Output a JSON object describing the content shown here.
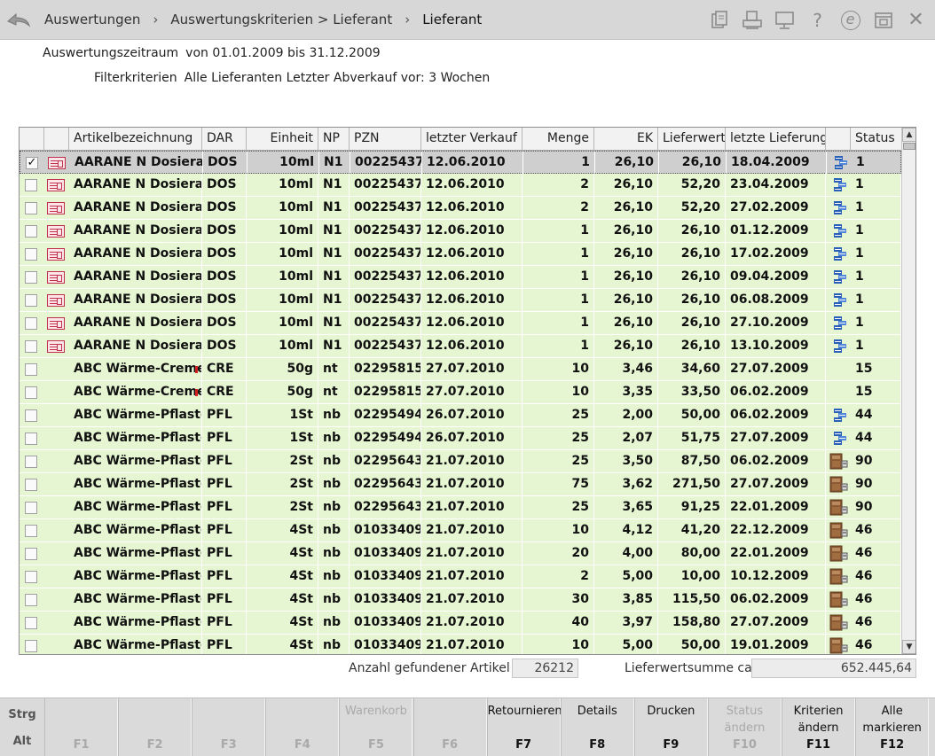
{
  "breadcrumb": [
    "Auswertungen",
    "Auswertungskriterien > Lieferant",
    "Lieferant"
  ],
  "toolbar_icons": [
    "clipboard-icon",
    "print-icon",
    "monitor-icon",
    "help-icon",
    "e-icon",
    "window-icon",
    "close-icon"
  ],
  "help_symbol": "?",
  "e_symbol": "e",
  "close_symbol": "✕",
  "period": {
    "label": "Auswertungszeitraum",
    "value": "von 01.01.2009 bis 31.12.2009"
  },
  "filter": {
    "label": "Filterkriterien",
    "value": "Alle Lieferanten Letzter Abverkauf vor: 3 Wochen"
  },
  "columns": [
    "Artikelbezeichnung",
    "DAR",
    "Einheit",
    "NP",
    "PZN",
    "letzter Verkauf",
    "Menge",
    "EK",
    "Lieferwert",
    "letzte Lieferung",
    "Status"
  ],
  "rows": [
    {
      "checked": true,
      "icon": "article",
      "name": "AARANE N Dosierae",
      "dar": "DOS",
      "einheit": "10ml",
      "np": "N1",
      "pzn": "00225437",
      "verkauf": "12.06.2010",
      "menge": "1",
      "ek": "26,10",
      "lieferwert": "26,10",
      "lieferung": "18.04.2009",
      "status_icon": "blue",
      "status": "1"
    },
    {
      "checked": false,
      "icon": "article",
      "name": "AARANE N Dosierae",
      "dar": "DOS",
      "einheit": "10ml",
      "np": "N1",
      "pzn": "00225437",
      "verkauf": "12.06.2010",
      "menge": "2",
      "ek": "26,10",
      "lieferwert": "52,20",
      "lieferung": "23.04.2009",
      "status_icon": "blue",
      "status": "1"
    },
    {
      "checked": false,
      "icon": "article",
      "name": "AARANE N Dosierae",
      "dar": "DOS",
      "einheit": "10ml",
      "np": "N1",
      "pzn": "00225437",
      "verkauf": "12.06.2010",
      "menge": "2",
      "ek": "26,10",
      "lieferwert": "52,20",
      "lieferung": "27.02.2009",
      "status_icon": "blue",
      "status": "1"
    },
    {
      "checked": false,
      "icon": "article",
      "name": "AARANE N Dosierae",
      "dar": "DOS",
      "einheit": "10ml",
      "np": "N1",
      "pzn": "00225437",
      "verkauf": "12.06.2010",
      "menge": "1",
      "ek": "26,10",
      "lieferwert": "26,10",
      "lieferung": "01.12.2009",
      "status_icon": "blue",
      "status": "1"
    },
    {
      "checked": false,
      "icon": "article",
      "name": "AARANE N Dosierae",
      "dar": "DOS",
      "einheit": "10ml",
      "np": "N1",
      "pzn": "00225437",
      "verkauf": "12.06.2010",
      "menge": "1",
      "ek": "26,10",
      "lieferwert": "26,10",
      "lieferung": "17.02.2009",
      "status_icon": "blue",
      "status": "1"
    },
    {
      "checked": false,
      "icon": "article",
      "name": "AARANE N Dosierae",
      "dar": "DOS",
      "einheit": "10ml",
      "np": "N1",
      "pzn": "00225437",
      "verkauf": "12.06.2010",
      "menge": "1",
      "ek": "26,10",
      "lieferwert": "26,10",
      "lieferung": "09.04.2009",
      "status_icon": "blue",
      "status": "1"
    },
    {
      "checked": false,
      "icon": "article",
      "name": "AARANE N Dosierae",
      "dar": "DOS",
      "einheit": "10ml",
      "np": "N1",
      "pzn": "00225437",
      "verkauf": "12.06.2010",
      "menge": "1",
      "ek": "26,10",
      "lieferwert": "26,10",
      "lieferung": "06.08.2009",
      "status_icon": "blue",
      "status": "1"
    },
    {
      "checked": false,
      "icon": "article",
      "name": "AARANE N Dosierae",
      "dar": "DOS",
      "einheit": "10ml",
      "np": "N1",
      "pzn": "00225437",
      "verkauf": "12.06.2010",
      "menge": "1",
      "ek": "26,10",
      "lieferwert": "26,10",
      "lieferung": "27.10.2009",
      "status_icon": "blue",
      "status": "1"
    },
    {
      "checked": false,
      "icon": "article",
      "name": "AARANE N Dosierae",
      "dar": "DOS",
      "einheit": "10ml",
      "np": "N1",
      "pzn": "00225437",
      "verkauf": "12.06.2010",
      "menge": "1",
      "ek": "26,10",
      "lieferwert": "26,10",
      "lieferung": "13.10.2009",
      "status_icon": "blue",
      "status": "1"
    },
    {
      "checked": false,
      "icon": "",
      "name": "ABC Wärme-Creme",
      "mark": true,
      "dar": "CRE",
      "einheit": "50g",
      "np": "nt",
      "pzn": "02295815",
      "verkauf": "27.07.2010",
      "menge": "10",
      "ek": "3,46",
      "lieferwert": "34,60",
      "lieferung": "27.07.2009",
      "status_icon": "",
      "status": "15"
    },
    {
      "checked": false,
      "icon": "",
      "name": "ABC Wärme-Creme",
      "mark": true,
      "dar": "CRE",
      "einheit": "50g",
      "np": "nt",
      "pzn": "02295815",
      "verkauf": "27.07.2010",
      "menge": "10",
      "ek": "3,35",
      "lieferwert": "33,50",
      "lieferung": "06.02.2009",
      "status_icon": "",
      "status": "15"
    },
    {
      "checked": false,
      "icon": "",
      "name": "ABC Wärme-Pflaster",
      "dar": "PFL",
      "einheit": "1St",
      "np": "nb",
      "pzn": "02295494",
      "verkauf": "26.07.2010",
      "menge": "25",
      "ek": "2,00",
      "lieferwert": "50,00",
      "lieferung": "06.02.2009",
      "status_icon": "blue",
      "status": "44"
    },
    {
      "checked": false,
      "icon": "",
      "name": "ABC Wärme-Pflaster",
      "dar": "PFL",
      "einheit": "1St",
      "np": "nb",
      "pzn": "02295494",
      "verkauf": "26.07.2010",
      "menge": "25",
      "ek": "2,07",
      "lieferwert": "51,75",
      "lieferung": "27.07.2009",
      "status_icon": "blue",
      "status": "44"
    },
    {
      "checked": false,
      "icon": "",
      "name": "ABC Wärme-Pflaster",
      "dar": "PFL",
      "einheit": "2St",
      "np": "nb",
      "pzn": "02295643",
      "verkauf": "21.07.2010",
      "menge": "25",
      "ek": "3,50",
      "lieferwert": "87,50",
      "lieferung": "06.02.2009",
      "status_icon": "box",
      "status": "90"
    },
    {
      "checked": false,
      "icon": "",
      "name": "ABC Wärme-Pflaster",
      "dar": "PFL",
      "einheit": "2St",
      "np": "nb",
      "pzn": "02295643",
      "verkauf": "21.07.2010",
      "menge": "75",
      "ek": "3,62",
      "lieferwert": "271,50",
      "lieferung": "27.07.2009",
      "status_icon": "box",
      "status": "90"
    },
    {
      "checked": false,
      "icon": "",
      "name": "ABC Wärme-Pflaster",
      "dar": "PFL",
      "einheit": "2St",
      "np": "nb",
      "pzn": "02295643",
      "verkauf": "21.07.2010",
      "menge": "25",
      "ek": "3,65",
      "lieferwert": "91,25",
      "lieferung": "22.01.2009",
      "status_icon": "box",
      "status": "90"
    },
    {
      "checked": false,
      "icon": "",
      "name": "ABC Wärme-Pflaster",
      "dar": "PFL",
      "einheit": "4St",
      "np": "nb",
      "pzn": "01033409",
      "verkauf": "21.07.2010",
      "menge": "10",
      "ek": "4,12",
      "lieferwert": "41,20",
      "lieferung": "22.12.2009",
      "status_icon": "box",
      "status": "46"
    },
    {
      "checked": false,
      "icon": "",
      "name": "ABC Wärme-Pflaster",
      "dar": "PFL",
      "einheit": "4St",
      "np": "nb",
      "pzn": "01033409",
      "verkauf": "21.07.2010",
      "menge": "20",
      "ek": "4,00",
      "lieferwert": "80,00",
      "lieferung": "22.01.2009",
      "status_icon": "box",
      "status": "46"
    },
    {
      "checked": false,
      "icon": "",
      "name": "ABC Wärme-Pflaster",
      "dar": "PFL",
      "einheit": "4St",
      "np": "nb",
      "pzn": "01033409",
      "verkauf": "21.07.2010",
      "menge": "2",
      "ek": "5,00",
      "lieferwert": "10,00",
      "lieferung": "10.12.2009",
      "status_icon": "box",
      "status": "46"
    },
    {
      "checked": false,
      "icon": "",
      "name": "ABC Wärme-Pflaster",
      "dar": "PFL",
      "einheit": "4St",
      "np": "nb",
      "pzn": "01033409",
      "verkauf": "21.07.2010",
      "menge": "30",
      "ek": "3,85",
      "lieferwert": "115,50",
      "lieferung": "06.02.2009",
      "status_icon": "box",
      "status": "46"
    },
    {
      "checked": false,
      "icon": "",
      "name": "ABC Wärme-Pflaster",
      "dar": "PFL",
      "einheit": "4St",
      "np": "nb",
      "pzn": "01033409",
      "verkauf": "21.07.2010",
      "menge": "40",
      "ek": "3,97",
      "lieferwert": "158,80",
      "lieferung": "27.07.2009",
      "status_icon": "box",
      "status": "46"
    },
    {
      "checked": false,
      "icon": "",
      "name": "ABC Wärme-Pflaster",
      "dar": "PFL",
      "einheit": "4St",
      "np": "nb",
      "pzn": "01033409",
      "verkauf": "21.07.2010",
      "menge": "10",
      "ek": "5,00",
      "lieferwert": "50,00",
      "lieferung": "19.01.2009",
      "status_icon": "box",
      "status": "46"
    }
  ],
  "summary": {
    "count_label": "Anzahl gefundener Artikel",
    "count_value": "26212",
    "sum_label": "Lieferwertsumme ca.",
    "sum_value": "652.445,64"
  },
  "modifiers": {
    "strg": "Strg",
    "alt": "Alt"
  },
  "fkeys": [
    {
      "label": "",
      "key": "F1",
      "enabled": false
    },
    {
      "label": "",
      "key": "F2",
      "enabled": false
    },
    {
      "label": "",
      "key": "F3",
      "enabled": false
    },
    {
      "label": "",
      "key": "F4",
      "enabled": false
    },
    {
      "label": "Warenkorb",
      "key": "F5",
      "enabled": false
    },
    {
      "label": "",
      "key": "F6",
      "enabled": false
    },
    {
      "label": "Retournieren",
      "key": "F7",
      "enabled": true
    },
    {
      "label": "Details",
      "key": "F8",
      "enabled": true
    },
    {
      "label": "Drucken",
      "key": "F9",
      "enabled": true
    },
    {
      "label": "Status\nändern",
      "key": "F10",
      "enabled": false
    },
    {
      "label": "Kriterien\nändern",
      "key": "F11",
      "enabled": true
    },
    {
      "label": "Alle\nmarkieren",
      "key": "F12",
      "enabled": true
    }
  ],
  "colors": {
    "row_bg": "#e6f6d2",
    "selected_bg": "#cfcfcf",
    "accent_red": "#c0304a",
    "status_blue": "#2a5fb8"
  }
}
